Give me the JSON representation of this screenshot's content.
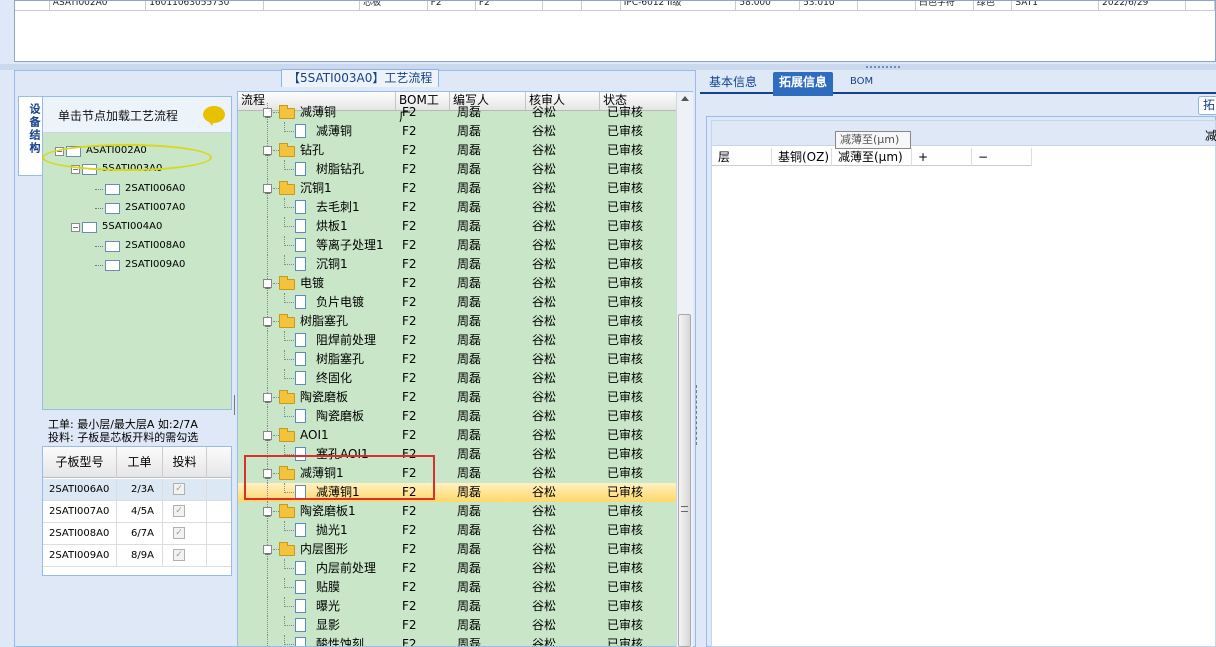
{
  "top_grid": {
    "row": [
      "",
      "ASATI002A0",
      "16011063055730",
      "",
      "芯板",
      "F2",
      "F2",
      "",
      "",
      "IPC-6012 II级",
      "58.000",
      "53.010",
      "",
      "白色字符",
      "绿色",
      "SAT1",
      "2022/6/29",
      ""
    ]
  },
  "flow_panel": {
    "caption": "【5SATI003A0】工艺流程",
    "vtab_label": "设备结构",
    "tree_hint": "单击节点加载工艺流程",
    "tree": [
      {
        "label": "ASATI002A0",
        "expand": "−"
      },
      {
        "label": "5SATI003A0",
        "expand": "−"
      },
      {
        "label": "2SATI006A0"
      },
      {
        "label": "2SATI007A0"
      },
      {
        "label": "5SATI004A0",
        "expand": "−"
      },
      {
        "label": "2SATI008A0"
      },
      {
        "label": "2SATI009A0"
      }
    ],
    "info_line1": "工单: 最小层/最大层A 如:2/7A",
    "info_line2": "投料: 子板是芯板开料的需勾选",
    "subgrid": {
      "headers": [
        "子板型号",
        "工单",
        "投料"
      ],
      "rows": [
        {
          "model": "2SATI006A0",
          "order": "2/3A",
          "check": "✓"
        },
        {
          "model": "2SATI007A0",
          "order": "4/5A",
          "check": "✓"
        },
        {
          "model": "2SATI008A0",
          "order": "6/7A",
          "check": "✓"
        },
        {
          "model": "2SATI009A0",
          "order": "8/9A",
          "check": "✓"
        }
      ]
    }
  },
  "flow_grid": {
    "headers": [
      "流程",
      "BOM工厂",
      "编写人",
      "核审人",
      "状态"
    ],
    "rows": [
      {
        "level": 0,
        "name": "减薄铜",
        "bom": "F2",
        "writer": "周磊",
        "checker": "谷松",
        "status": "已审核"
      },
      {
        "level": 1,
        "name": "减薄铜",
        "bom": "F2",
        "writer": "周磊",
        "checker": "谷松",
        "status": "已审核"
      },
      {
        "level": 0,
        "name": "钻孔",
        "bom": "F2",
        "writer": "周磊",
        "checker": "谷松",
        "status": "已审核"
      },
      {
        "level": 1,
        "name": "树脂钻孔",
        "bom": "F2",
        "writer": "周磊",
        "checker": "谷松",
        "status": "已审核"
      },
      {
        "level": 0,
        "name": "沉铜1",
        "bom": "F2",
        "writer": "周磊",
        "checker": "谷松",
        "status": "已审核"
      },
      {
        "level": 1,
        "name": "去毛刺1",
        "bom": "F2",
        "writer": "周磊",
        "checker": "谷松",
        "status": "已审核"
      },
      {
        "level": 1,
        "name": "烘板1",
        "bom": "F2",
        "writer": "周磊",
        "checker": "谷松",
        "status": "已审核"
      },
      {
        "level": 1,
        "name": "等离子处理1",
        "bom": "F2",
        "writer": "周磊",
        "checker": "谷松",
        "status": "已审核"
      },
      {
        "level": 1,
        "name": "沉铜1",
        "bom": "F2",
        "writer": "周磊",
        "checker": "谷松",
        "status": "已审核"
      },
      {
        "level": 0,
        "name": "电镀",
        "bom": "F2",
        "writer": "周磊",
        "checker": "谷松",
        "status": "已审核"
      },
      {
        "level": 1,
        "name": "负片电镀",
        "bom": "F2",
        "writer": "周磊",
        "checker": "谷松",
        "status": "已审核"
      },
      {
        "level": 0,
        "name": "树脂塞孔",
        "bom": "F2",
        "writer": "周磊",
        "checker": "谷松",
        "status": "已审核"
      },
      {
        "level": 1,
        "name": "阻焊前处理",
        "bom": "F2",
        "writer": "周磊",
        "checker": "谷松",
        "status": "已审核"
      },
      {
        "level": 1,
        "name": "树脂塞孔",
        "bom": "F2",
        "writer": "周磊",
        "checker": "谷松",
        "status": "已审核"
      },
      {
        "level": 1,
        "name": "终固化",
        "bom": "F2",
        "writer": "周磊",
        "checker": "谷松",
        "status": "已审核"
      },
      {
        "level": 0,
        "name": "陶瓷磨板",
        "bom": "F2",
        "writer": "周磊",
        "checker": "谷松",
        "status": "已审核"
      },
      {
        "level": 1,
        "name": "陶瓷磨板",
        "bom": "F2",
        "writer": "周磊",
        "checker": "谷松",
        "status": "已审核"
      },
      {
        "level": 0,
        "name": "AOI1",
        "bom": "F2",
        "writer": "周磊",
        "checker": "谷松",
        "status": "已审核"
      },
      {
        "level": 1,
        "name": "塞孔AOI1",
        "bom": "F2",
        "writer": "周磊",
        "checker": "谷松",
        "status": "已审核"
      },
      {
        "level": 0,
        "name": "减薄铜1",
        "bom": "F2",
        "writer": "周磊",
        "checker": "谷松",
        "status": "已审核"
      },
      {
        "level": 1,
        "name": "减薄铜1",
        "bom": "F2",
        "writer": "周磊",
        "checker": "谷松",
        "status": "已审核",
        "selected": true
      },
      {
        "level": 0,
        "name": "陶瓷磨板1",
        "bom": "F2",
        "writer": "周磊",
        "checker": "谷松",
        "status": "已审核"
      },
      {
        "level": 1,
        "name": "抛光1",
        "bom": "F2",
        "writer": "周磊",
        "checker": "谷松",
        "status": "已审核"
      },
      {
        "level": 0,
        "name": "内层图形",
        "bom": "F2",
        "writer": "周磊",
        "checker": "谷松",
        "status": "已审核"
      },
      {
        "level": 1,
        "name": "内层前处理",
        "bom": "F2",
        "writer": "周磊",
        "checker": "谷松",
        "status": "已审核"
      },
      {
        "level": 1,
        "name": "贴膜",
        "bom": "F2",
        "writer": "周磊",
        "checker": "谷松",
        "status": "已审核"
      },
      {
        "level": 1,
        "name": "曝光",
        "bom": "F2",
        "writer": "周磊",
        "checker": "谷松",
        "status": "已审核"
      },
      {
        "level": 1,
        "name": "显影",
        "bom": "F2",
        "writer": "周磊",
        "checker": "谷松",
        "status": "已审核"
      },
      {
        "level": 1,
        "name": "酸性蚀刻",
        "bom": "F2",
        "writer": "周磊",
        "checker": "谷松",
        "status": "已审核"
      }
    ]
  },
  "right_panel": {
    "tabs": [
      "基本信息",
      "拓展信息",
      "BOM"
    ],
    "active_tab": "拓展信息",
    "side_button": "拓",
    "grid_bar_text": "减",
    "tooltip": "减薄至(μm)",
    "headers": [
      "层",
      "基铜(OZ)",
      "减薄至(μm)",
      "+",
      "−"
    ]
  },
  "colors": {
    "tree_bg": "#c9e6c8",
    "selected_row": "#ffd86a",
    "highlight_box": "#d9302c",
    "ellipse": "#d8d81a",
    "active_tab": "#2d6cbf"
  }
}
